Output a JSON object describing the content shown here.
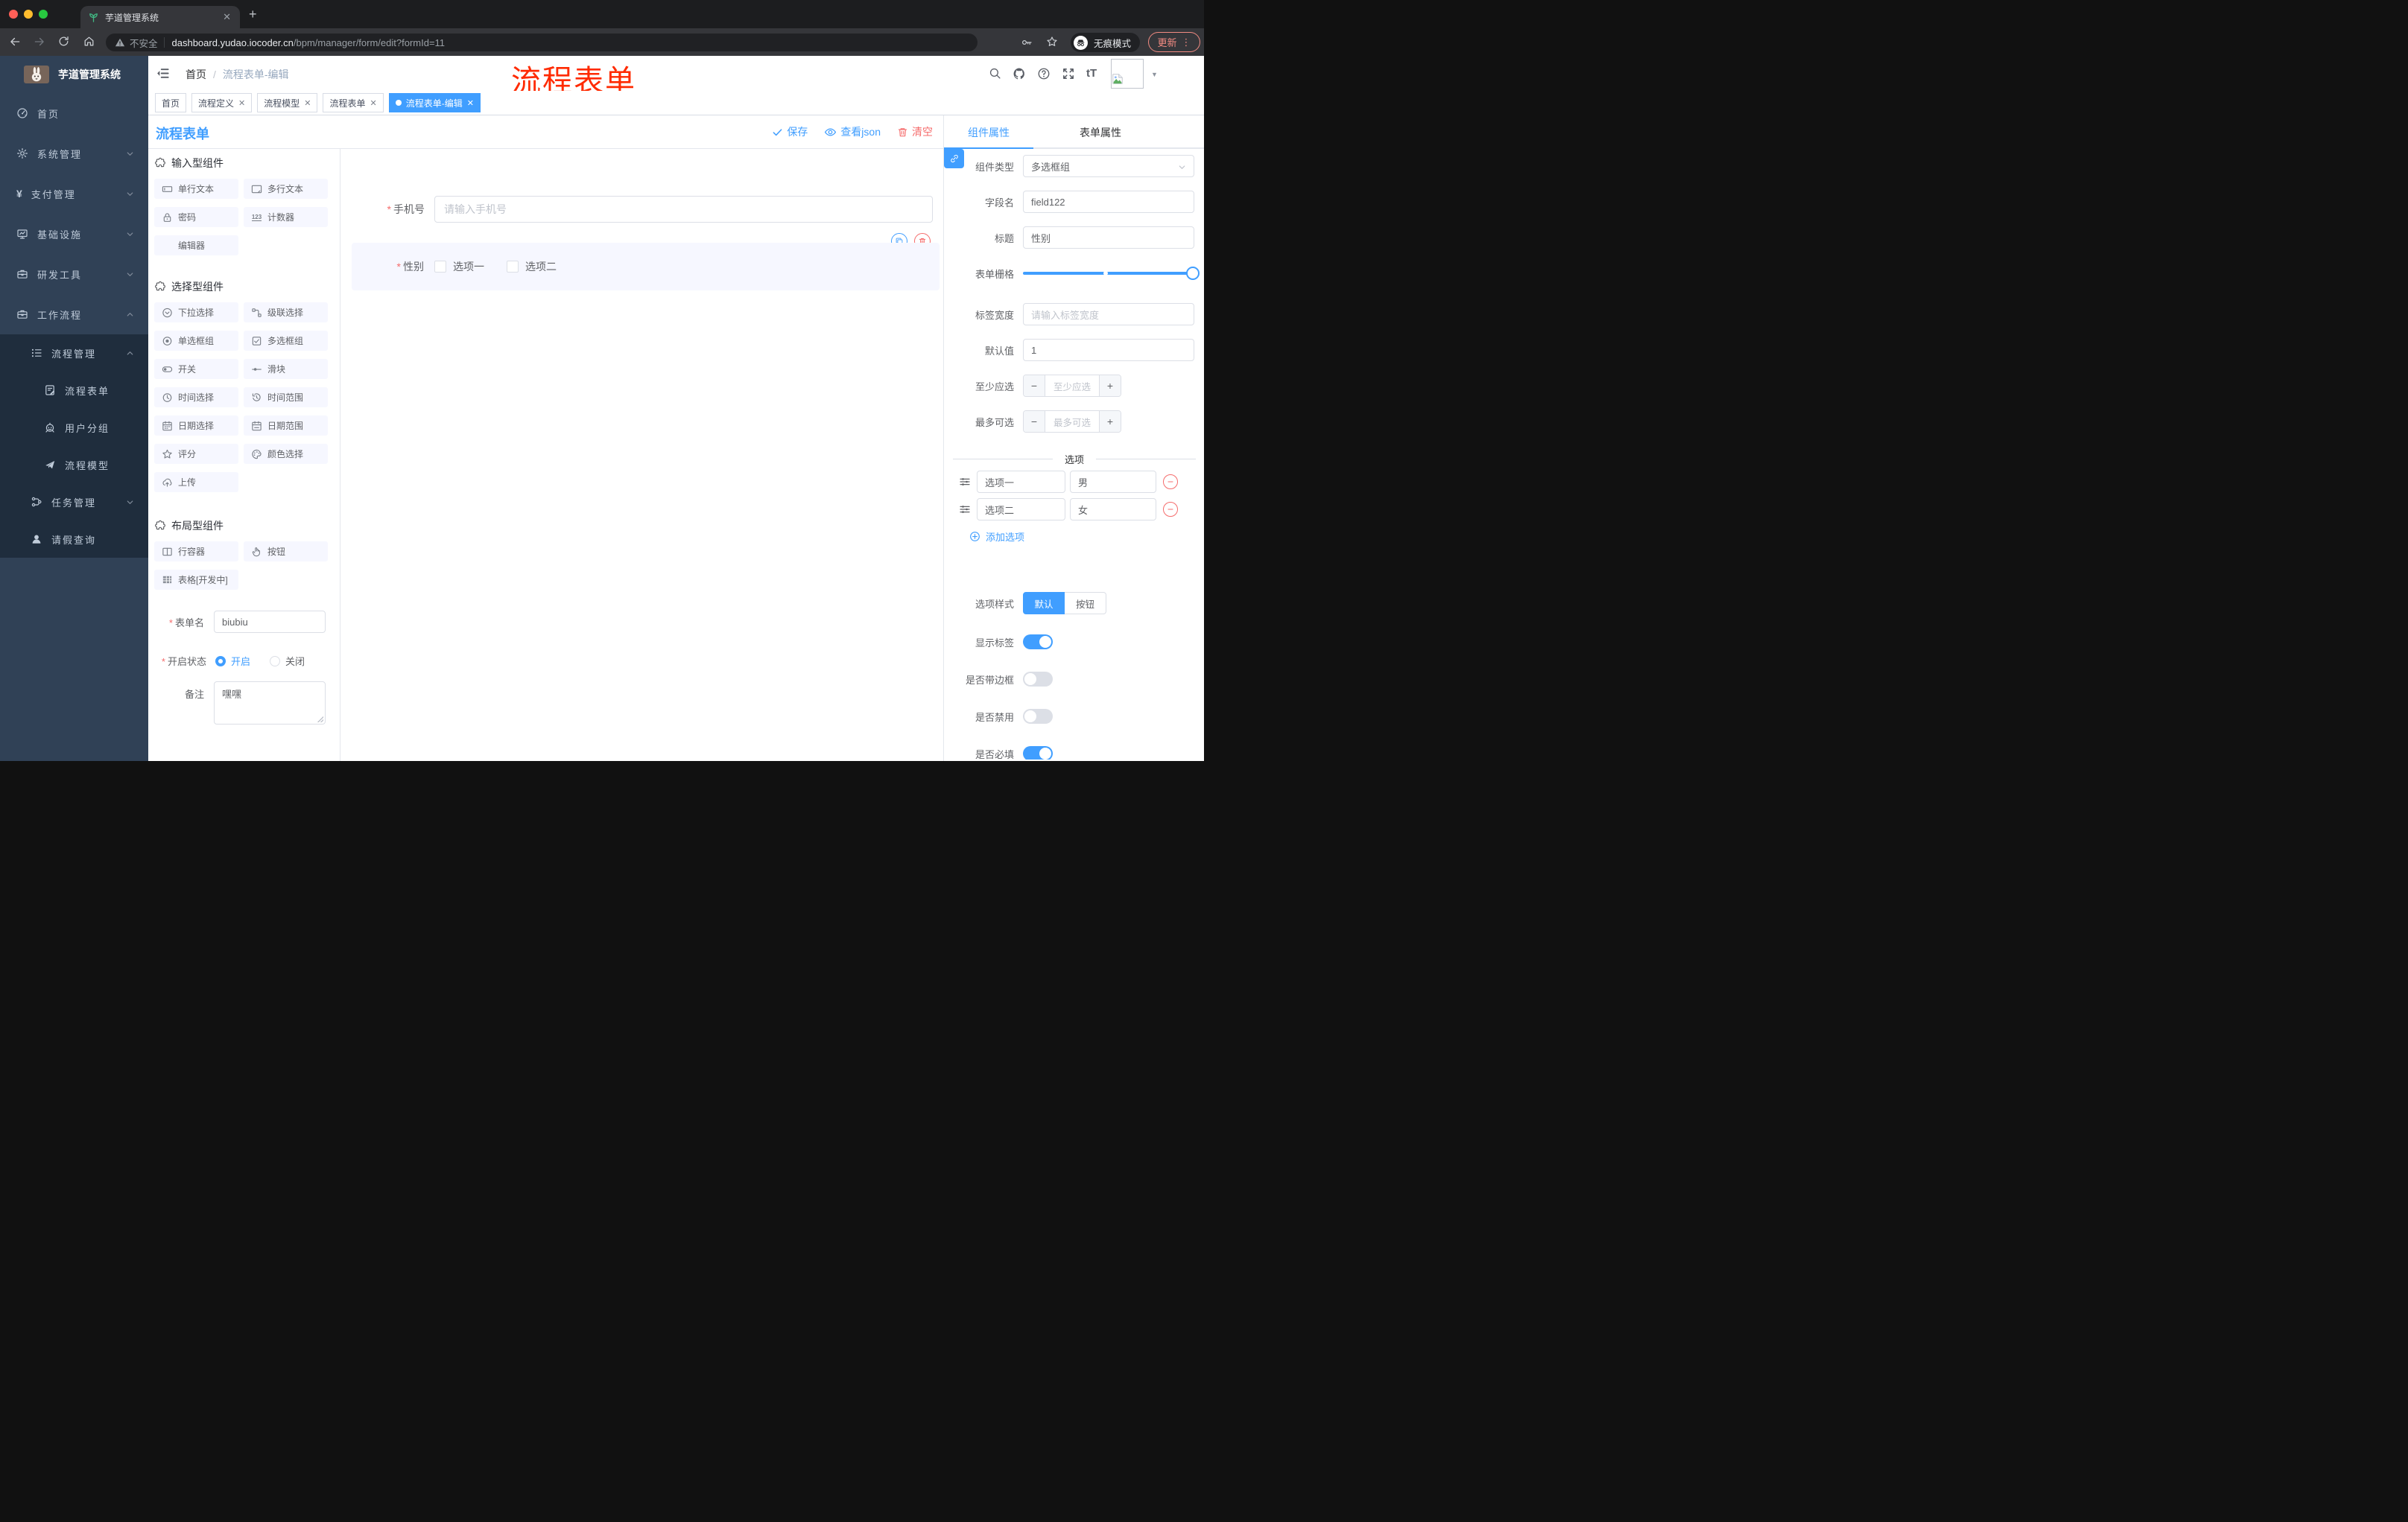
{
  "browser": {
    "tab_title": "芋道管理系统",
    "security_label": "不安全",
    "url_host": "dashboard.yudao.iocoder.cn",
    "url_path": "/bpm/manager/form/edit?formId=11",
    "incognito_label": "无痕模式",
    "update_label": "更新"
  },
  "sidebar": {
    "logo_title": "芋道管理系统",
    "items": [
      {
        "label": "首页",
        "icon": "dashboard",
        "level": 1,
        "arrow": ""
      },
      {
        "label": "系统管理",
        "icon": "gear",
        "level": 1,
        "arrow": "down"
      },
      {
        "label": "支付管理",
        "icon": "yen",
        "level": 1,
        "arrow": "down"
      },
      {
        "label": "基础设施",
        "icon": "monitor",
        "level": 1,
        "arrow": "down"
      },
      {
        "label": "研发工具",
        "icon": "suitcase",
        "level": 1,
        "arrow": "down"
      },
      {
        "label": "工作流程",
        "icon": "suitcase",
        "level": 1,
        "arrow": "up"
      },
      {
        "label": "流程管理",
        "icon": "list-tree",
        "level": 2,
        "arrow": "up"
      },
      {
        "label": "流程表单",
        "icon": "doc-edit",
        "level": 3,
        "arrow": ""
      },
      {
        "label": "用户分组",
        "icon": "robot",
        "level": 3,
        "arrow": ""
      },
      {
        "label": "流程模型",
        "icon": "paper-plane",
        "level": 3,
        "arrow": ""
      },
      {
        "label": "任务管理",
        "icon": "tree",
        "level": 2,
        "arrow": "down"
      },
      {
        "label": "请假查询",
        "icon": "user",
        "level": 2,
        "arrow": ""
      }
    ]
  },
  "header": {
    "breadcrumb": [
      "首页",
      "流程表单-编辑"
    ],
    "separator": "/",
    "annotation": "流程表单",
    "icons": [
      {
        "name": "search"
      },
      {
        "name": "github"
      },
      {
        "name": "question"
      },
      {
        "name": "fullscreen"
      },
      {
        "name": "font-size"
      }
    ]
  },
  "route_tabs": [
    {
      "label": "首页",
      "closable": false,
      "active": false
    },
    {
      "label": "流程定义",
      "closable": true,
      "active": false
    },
    {
      "label": "流程模型",
      "closable": true,
      "active": false
    },
    {
      "label": "流程表单",
      "closable": true,
      "active": false
    },
    {
      "label": "流程表单-编辑",
      "closable": true,
      "active": true
    }
  ],
  "toolbar": {
    "title": "流程表单",
    "save_label": "保存",
    "view_json_label": "查看json",
    "clear_label": "清空"
  },
  "components_panel": {
    "sections": [
      {
        "title": "输入型组件",
        "items": [
          {
            "label": "单行文本",
            "icon": "input"
          },
          {
            "label": "多行文本",
            "icon": "textarea"
          },
          {
            "label": "密码",
            "icon": "lock"
          },
          {
            "label": "计数器",
            "icon": "counter"
          },
          {
            "label": "编辑器",
            "icon": ""
          }
        ]
      },
      {
        "title": "选择型组件",
        "items": [
          {
            "label": "下拉选择",
            "icon": "select"
          },
          {
            "label": "级联选择",
            "icon": "cascade"
          },
          {
            "label": "单选框组",
            "icon": "radio"
          },
          {
            "label": "多选框组",
            "icon": "checkbox"
          },
          {
            "label": "开关",
            "icon": "switch"
          },
          {
            "label": "滑块",
            "icon": "slider"
          },
          {
            "label": "时间选择",
            "icon": "time"
          },
          {
            "label": "时间范围",
            "icon": "time-range"
          },
          {
            "label": "日期选择",
            "icon": "date"
          },
          {
            "label": "日期范围",
            "icon": "date-range"
          },
          {
            "label": "评分",
            "icon": "star"
          },
          {
            "label": "颜色选择",
            "icon": "palette"
          },
          {
            "label": "上传",
            "icon": "upload"
          }
        ]
      },
      {
        "title": "布局型组件",
        "items": [
          {
            "label": "行容器",
            "icon": "row"
          },
          {
            "label": "按钮",
            "icon": "hand"
          },
          {
            "label": "表格[开发中]",
            "icon": "table"
          }
        ]
      }
    ],
    "form": {
      "name_label": "表单名",
      "name_value": "biubiu",
      "status_label": "开启状态",
      "status_options": [
        {
          "label": "开启",
          "checked": true
        },
        {
          "label": "关闭",
          "checked": false
        }
      ],
      "remark_label": "备注",
      "remark_value": "嘿嘿"
    }
  },
  "canvas": {
    "phone_field": {
      "label": "手机号",
      "placeholder": "请输入手机号",
      "required": true
    },
    "gender_field": {
      "label": "性别",
      "required": true,
      "options": [
        "选项一",
        "选项二"
      ]
    }
  },
  "props_panel": {
    "tabs": [
      {
        "label": "组件属性",
        "active": true
      },
      {
        "label": "表单属性",
        "active": false
      }
    ],
    "rows": [
      {
        "kind": "select",
        "label": "组件类型",
        "value": "多选框组"
      },
      {
        "kind": "input",
        "label": "字段名",
        "value": "field122"
      },
      {
        "kind": "input",
        "label": "标题",
        "value": "性别"
      },
      {
        "kind": "slider",
        "label": "表单栅格"
      },
      {
        "kind": "input",
        "label": "标签宽度",
        "placeholder": "请输入标签宽度"
      },
      {
        "kind": "input",
        "label": "默认值",
        "value": "1"
      },
      {
        "kind": "stepper",
        "label": "至少应选",
        "placeholder": "至少应选"
      },
      {
        "kind": "stepper",
        "label": "最多可选",
        "placeholder": "最多可选"
      }
    ],
    "options_section": {
      "heading": "选项",
      "rows": [
        {
          "name": "选项一",
          "value": "男"
        },
        {
          "name": "选项二",
          "value": "女"
        }
      ],
      "add_label": "添加选项"
    },
    "style_row": {
      "label": "选项样式",
      "options": [
        {
          "label": "默认",
          "active": true
        },
        {
          "label": "按钮",
          "active": false
        }
      ]
    },
    "toggles": [
      {
        "label": "显示标签",
        "on": true
      },
      {
        "label": "是否带边框",
        "on": false
      },
      {
        "label": "是否禁用",
        "on": false
      },
      {
        "label": "是否必填",
        "on": true
      }
    ]
  },
  "colors": {
    "accent": "#409eff",
    "danger": "#f56c6c",
    "annotation": "#ff2a00"
  }
}
